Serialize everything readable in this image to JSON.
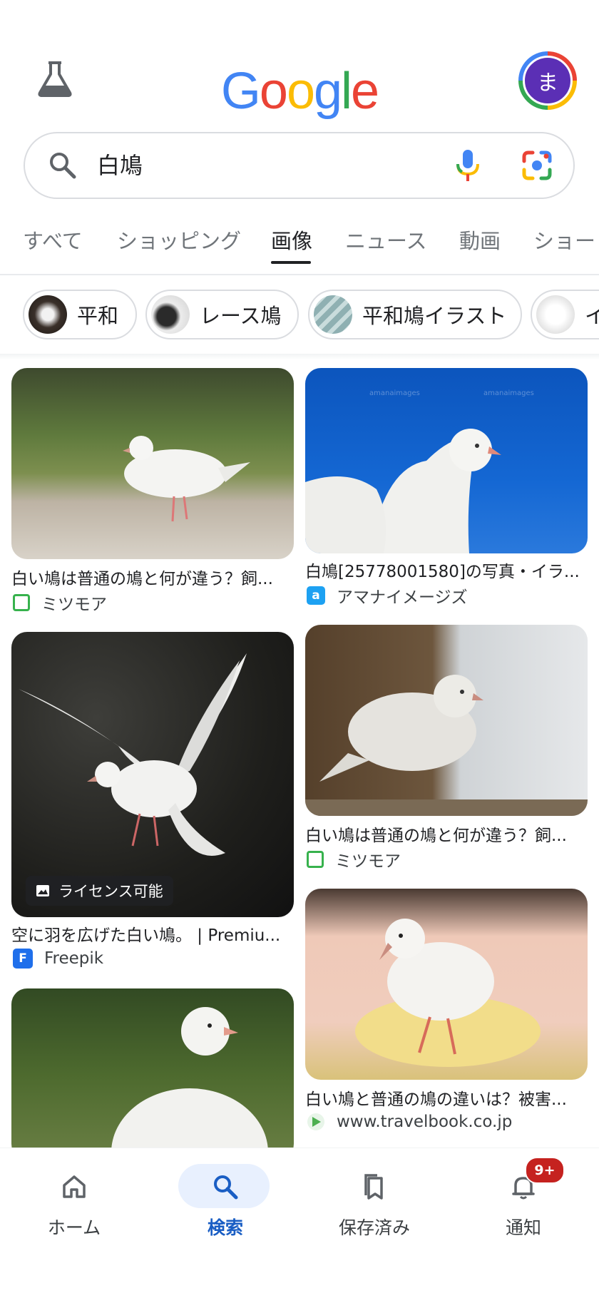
{
  "header": {
    "logo": [
      "G",
      "o",
      "o",
      "g",
      "l",
      "e"
    ],
    "avatar_initial": "ま"
  },
  "search": {
    "query": "白鳩"
  },
  "tabs": [
    "すべて",
    "ショッピング",
    "画像",
    "ニュース",
    "動画",
    "ショー"
  ],
  "active_tab": "画像",
  "chips": [
    "平和",
    "レース鳩",
    "平和鳩イラスト",
    "イ"
  ],
  "results": [
    {
      "title": "白い鳩は普通の鳩と何が違う？飼...",
      "source": "ミツモア",
      "icon": "mitsumore-icon"
    },
    {
      "title": "白鳩[25778001580]の写真・イラ...",
      "source": "アマナイメージズ",
      "icon": "amana-icon"
    },
    {
      "title": "空に羽を広げた白い鳩。 | Premiu...",
      "source": "Freepik",
      "icon": "freepik-icon",
      "badge": "ライセンス可能"
    },
    {
      "title": "白い鳩は普通の鳩と何が違う？飼...",
      "source": "ミツモア",
      "icon": "mitsumore-icon"
    },
    {
      "title": "白い鳩と普通の鳩の違いは？被害...",
      "source": "www.travelbook.co.jp",
      "icon": "travelbook-icon"
    },
    {
      "title": "",
      "source": "",
      "icon": ""
    }
  ],
  "watermark": "amanaimages",
  "bottom_nav": [
    {
      "label": "ホーム",
      "icon": "home-icon"
    },
    {
      "label": "検索",
      "icon": "search-icon"
    },
    {
      "label": "保存済み",
      "icon": "bookmark-icon"
    },
    {
      "label": "通知",
      "icon": "bell-icon"
    }
  ],
  "notification_badge": "9+",
  "colors": {
    "google_blue": "#4285f4",
    "google_red": "#ea4335",
    "google_yellow": "#fbbc05",
    "google_green": "#34a853",
    "active_nav": "#1a5ec4",
    "nav_pill": "#e8f0fe",
    "avatar": "#5b2fb5",
    "badge": "#c5221f"
  }
}
